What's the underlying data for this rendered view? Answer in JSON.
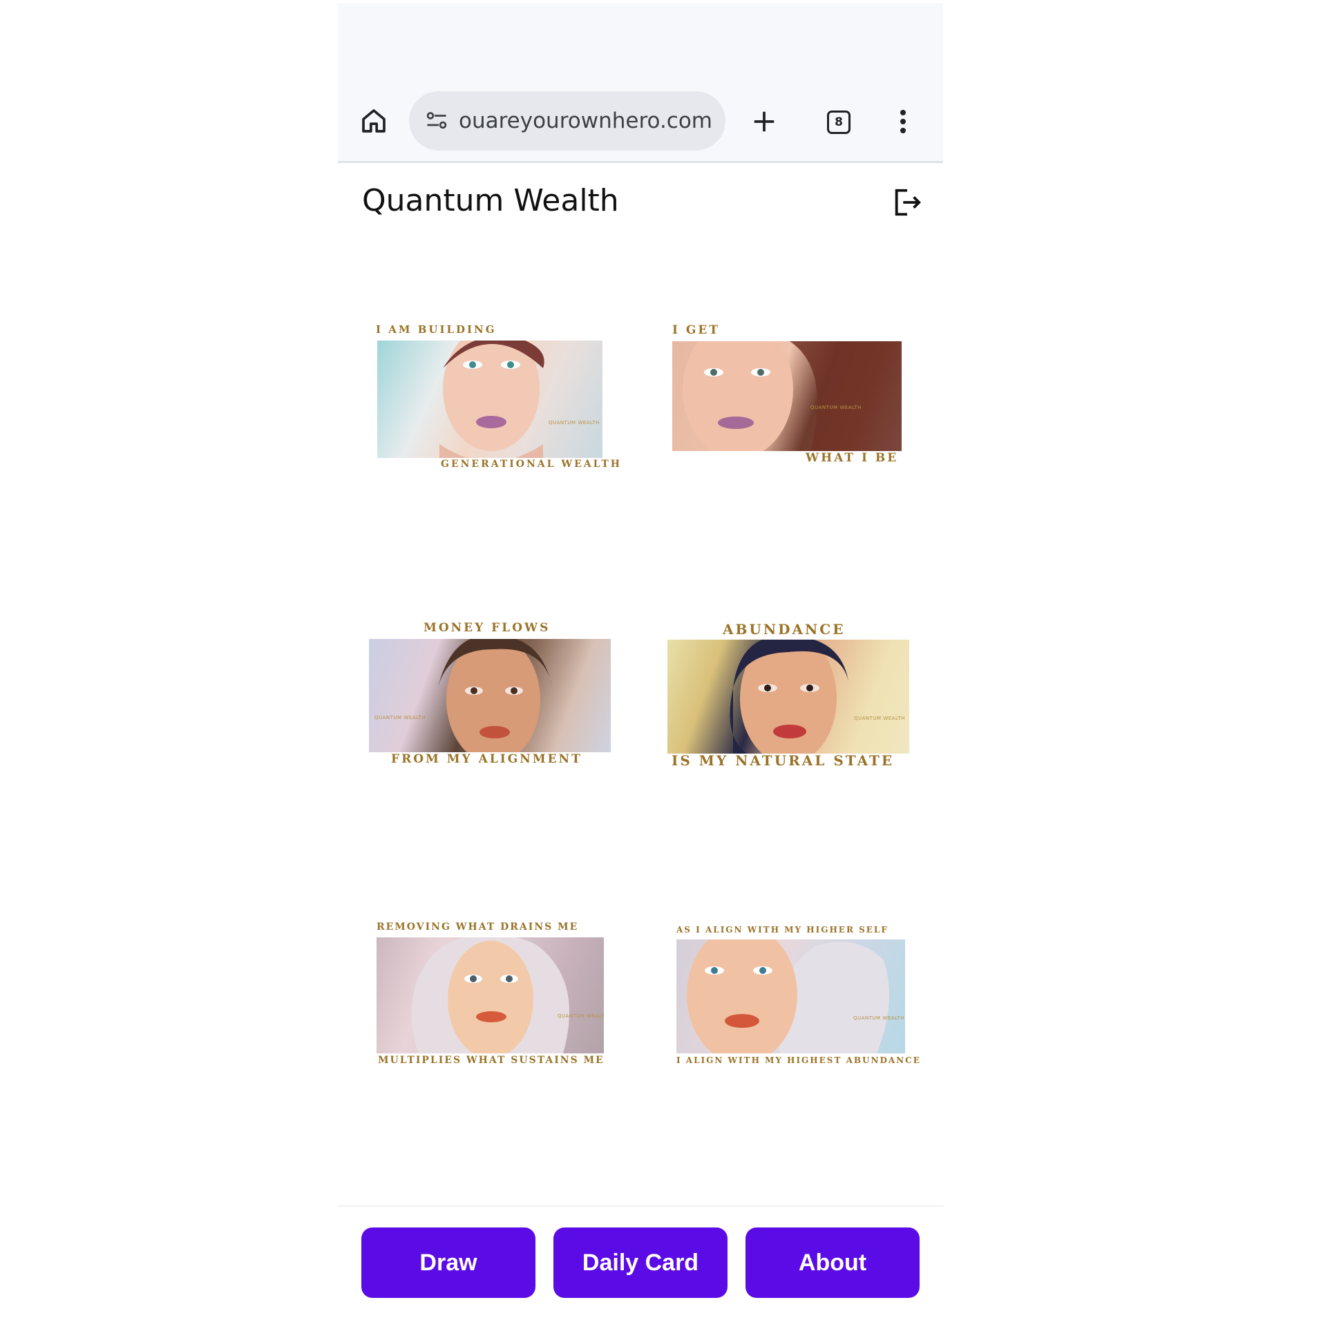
{
  "browser": {
    "url": "ouareyourownhero.com",
    "tab_count": "8",
    "icons": {
      "home": "home-icon",
      "site_settings": "tune-icon",
      "new_tab": "plus-icon",
      "tabs": "tab-switcher-icon",
      "menu": "more-vert-icon"
    }
  },
  "app": {
    "title": "Quantum Wealth",
    "logout_icon": "logout-icon"
  },
  "cards": [
    {
      "top": "I AM BUILDING",
      "bottom": "GENERATIONAL WEALTH",
      "watermark": "QUANTUM WEALTH"
    },
    {
      "top": "I GET",
      "bottom": "WHAT I BE",
      "watermark": "QUANTUM WEALTH"
    },
    {
      "top": "MONEY FLOWS",
      "bottom": "FROM MY ALIGNMENT",
      "watermark": "QUANTUM WEALTH"
    },
    {
      "top": "ABUNDANCE",
      "bottom": "IS MY NATURAL STATE",
      "watermark": "QUANTUM WEALTH"
    },
    {
      "top": "REMOVING WHAT DRAINS ME",
      "bottom": "MULTIPLIES WHAT SUSTAINS ME",
      "watermark": "QUANTUM WEALTH"
    },
    {
      "top": "AS I ALIGN WITH MY HIGHER SELF",
      "bottom": "I ALIGN WITH MY HIGHEST ABUNDANCE",
      "watermark": "QUANTUM WEALTH"
    }
  ],
  "nav": {
    "draw": "Draw",
    "daily_card": "Daily Card",
    "about": "About"
  },
  "colors": {
    "accent": "#5b0be6",
    "gold_text": "#9a7328",
    "browser_bg": "#f7f8fc",
    "urlbar_bg": "#e6e8ee"
  }
}
